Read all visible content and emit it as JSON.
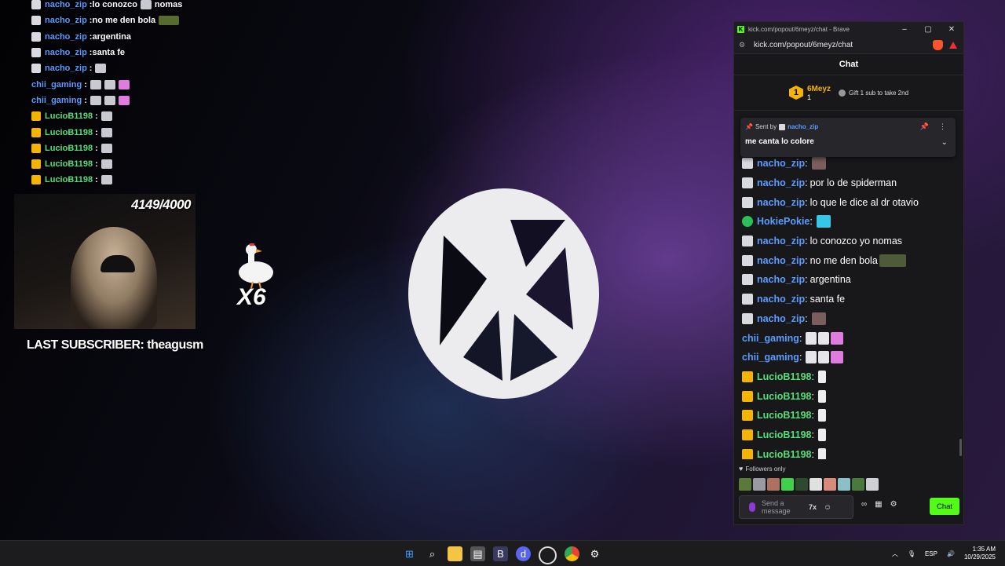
{
  "overlay": {
    "lines": [
      {
        "user": "nacho_zip",
        "color": "#5b9cff",
        "badge": "mod",
        "text": "lo conozco",
        "emote": "img",
        "after": "nomas"
      },
      {
        "user": "nacho_zip",
        "color": "#5b9cff",
        "badge": "mod",
        "text": "no me den bola",
        "emote": "wide",
        "after": ""
      },
      {
        "user": "nacho_zip",
        "color": "#5b9cff",
        "badge": "mod",
        "text": "argentina",
        "emote": "",
        "after": ""
      },
      {
        "user": "nacho_zip",
        "color": "#5b9cff",
        "badge": "mod",
        "text": "santa fe",
        "emote": "",
        "after": ""
      },
      {
        "user": "nacho_zip",
        "color": "#5b9cff",
        "badge": "mod",
        "text": "",
        "emote": "img",
        "after": ""
      },
      {
        "user": "chii_gaming",
        "color": "#5b9cff",
        "badge": "",
        "text": "",
        "emote": "catcatw",
        "after": ""
      },
      {
        "user": "chii_gaming",
        "color": "#5b9cff",
        "badge": "",
        "text": "",
        "emote": "catcatw",
        "after": ""
      },
      {
        "user": "LucioB1198",
        "color": "#53e07a",
        "badge": "crown",
        "text": "",
        "emote": "hand",
        "after": ""
      },
      {
        "user": "LucioB1198",
        "color": "#53e07a",
        "badge": "crown",
        "text": "",
        "emote": "hand",
        "after": ""
      },
      {
        "user": "LucioB1198",
        "color": "#53e07a",
        "badge": "crown",
        "text": "",
        "emote": "hand",
        "after": ""
      },
      {
        "user": "LucioB1198",
        "color": "#53e07a",
        "badge": "crown",
        "text": "",
        "emote": "hand",
        "after": ""
      },
      {
        "user": "LucioB1198",
        "color": "#53e07a",
        "badge": "crown",
        "text": "",
        "emote": "hand",
        "after": ""
      }
    ],
    "sub_goal": "4149/4000",
    "last_subscriber": "LAST SUBSCRIBER: theagusm",
    "goose_count": "X6"
  },
  "browser": {
    "title": "kick.com/popout/6meyz/chat - Brave",
    "url": "kick.com/popout/6meyz/chat",
    "icons": {
      "site": "kick-logo-icon",
      "shield": "brave-shield-icon"
    }
  },
  "chat": {
    "header": "Chat",
    "leaderboard": {
      "rank": "1",
      "user": "6Meyz",
      "count": "1",
      "gift_text": "Gift 1 sub to take 2nd"
    },
    "pinned": {
      "sent_by": "Sent by",
      "user": "nacho_zip",
      "text": "me canta lo colore"
    },
    "messages": [
      {
        "user": "nacho_zip",
        "color": "#5b9cff",
        "badge": "mod",
        "text": "",
        "emote": "img"
      },
      {
        "user": "nacho_zip",
        "color": "#5b9cff",
        "badge": "mod",
        "text": "por lo de spiderman",
        "emote": ""
      },
      {
        "user": "nacho_zip",
        "color": "#5b9cff",
        "badge": "mod",
        "text": "lo que le dice al dr otavio",
        "emote": ""
      },
      {
        "user": "HokiePokie",
        "color": "#5b9cff",
        "badge": "verified",
        "text": "",
        "emote": "gem"
      },
      {
        "user": "nacho_zip",
        "color": "#5b9cff",
        "badge": "mod",
        "text": "lo conozco yo nomas",
        "emote": ""
      },
      {
        "user": "nacho_zip",
        "color": "#5b9cff",
        "badge": "mod",
        "text": "no me den bola",
        "emote": "wide"
      },
      {
        "user": "nacho_zip",
        "color": "#5b9cff",
        "badge": "mod",
        "text": "argentina",
        "emote": ""
      },
      {
        "user": "nacho_zip",
        "color": "#5b9cff",
        "badge": "mod",
        "text": "santa fe",
        "emote": ""
      },
      {
        "user": "nacho_zip",
        "color": "#5b9cff",
        "badge": "mod",
        "text": "",
        "emote": "img"
      },
      {
        "user": "chii_gaming",
        "color": "#5b9cff",
        "badge": "",
        "text": "",
        "emote": "catcatw"
      },
      {
        "user": "chii_gaming",
        "color": "#5b9cff",
        "badge": "",
        "text": "",
        "emote": "catcatw"
      },
      {
        "user": "LucioB1198",
        "color": "#53e07a",
        "badge": "crown",
        "text": "",
        "emote": "hand"
      },
      {
        "user": "LucioB1198",
        "color": "#53e07a",
        "badge": "crown",
        "text": "",
        "emote": "hand"
      },
      {
        "user": "LucioB1198",
        "color": "#53e07a",
        "badge": "crown",
        "text": "",
        "emote": "hand"
      },
      {
        "user": "LucioB1198",
        "color": "#53e07a",
        "badge": "crown",
        "text": "",
        "emote": "hand"
      },
      {
        "user": "LucioB1198",
        "color": "#53e07a",
        "badge": "crown",
        "text": "",
        "emote": "hand"
      }
    ],
    "followers_only": "Followers only",
    "composer_placeholder": "Send a message",
    "send_label": "Chat",
    "accent": "#53fc18"
  },
  "taskbar": {
    "icons": [
      "windows-start-icon",
      "search-icon",
      "file-explorer-icon",
      "store-icon",
      "brave-browser-icon",
      "discord-icon",
      "obs-icon",
      "chrome-icon",
      "steam-icon"
    ],
    "lang": "ESP",
    "time": "1:35 AM",
    "date": "10/29/2025"
  }
}
